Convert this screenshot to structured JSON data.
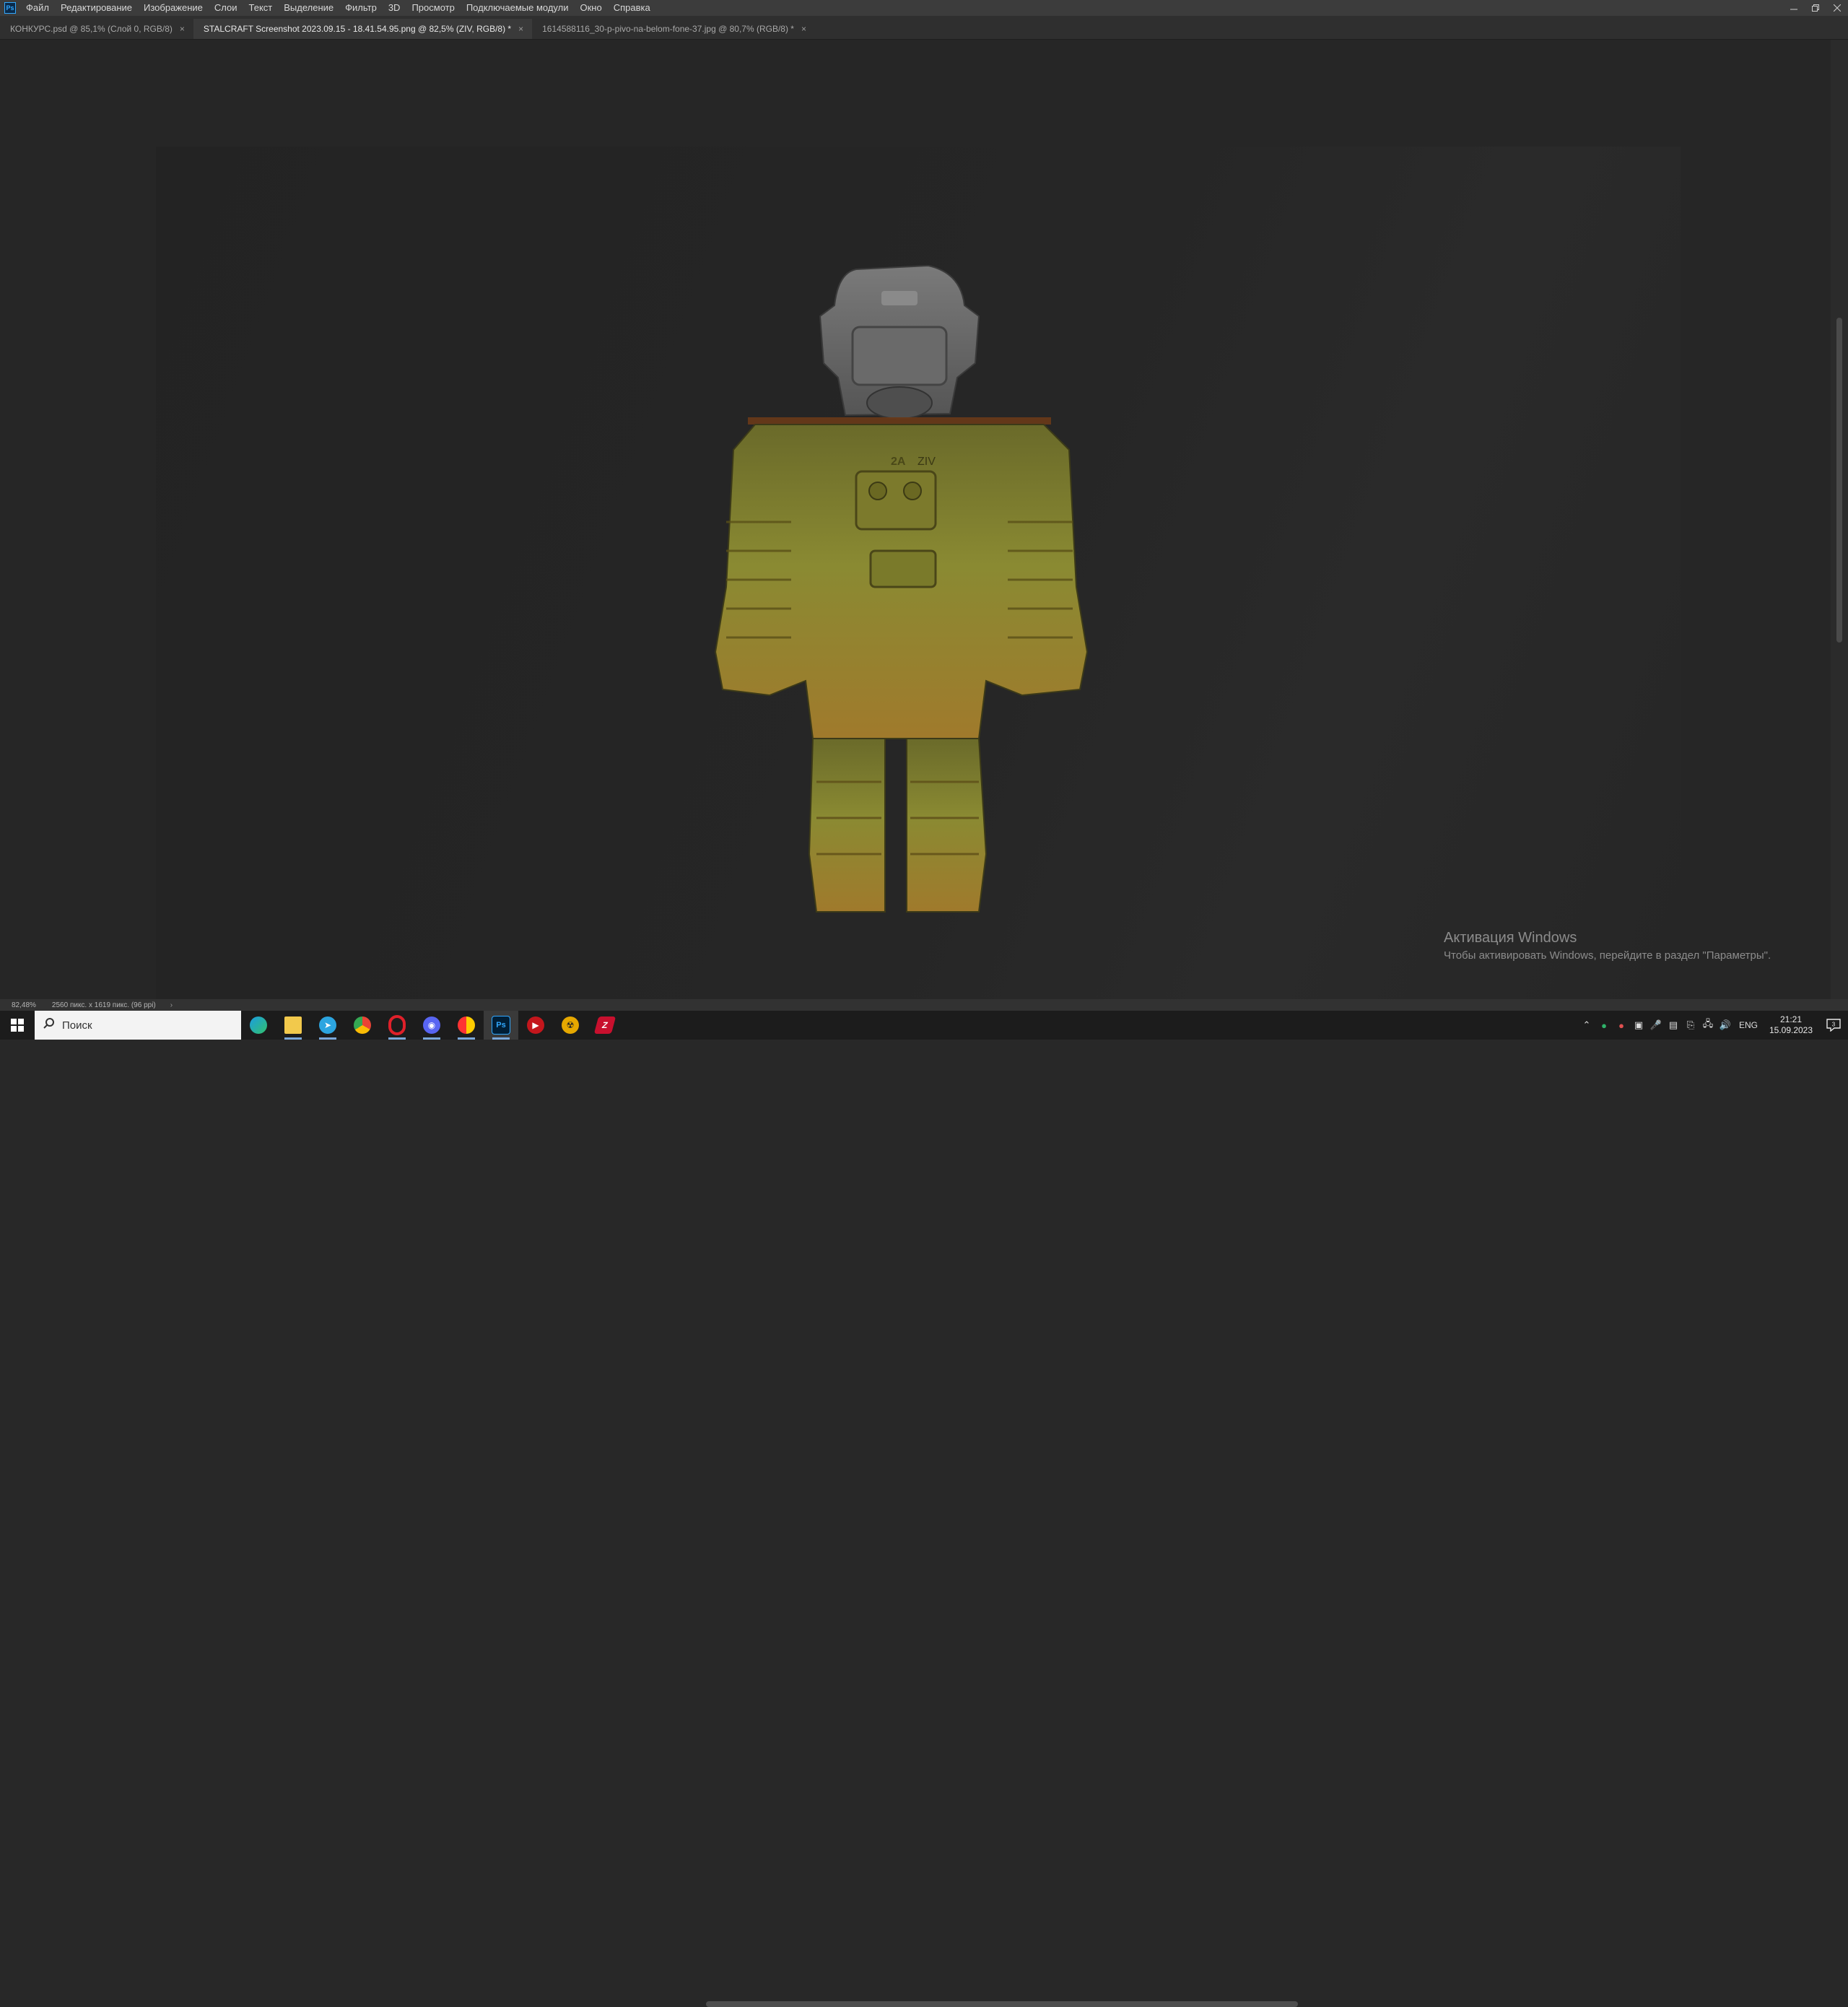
{
  "menu": {
    "app_logo": "Ps",
    "items": [
      "Файл",
      "Редактирование",
      "Изображение",
      "Слои",
      "Текст",
      "Выделение",
      "Фильтр",
      "3D",
      "Просмотр",
      "Подключаемые модули",
      "Окно",
      "Справка"
    ],
    "window_buttons": [
      "minimize-icon",
      "restore-icon",
      "close-icon"
    ]
  },
  "tabs": [
    {
      "label": "КОНКУРС.psd @ 85,1% (Слой 0, RGB/8)",
      "active": false
    },
    {
      "label": "STALCRAFT Screenshot 2023.09.15 - 18.41.54.95.png @ 82,5% (ZIV, RGB/8) *",
      "active": true
    },
    {
      "label": "1614588116_30-p-pivo-na-belom-fone-37.jpg @ 80,7% (RGB/8) *",
      "active": false
    }
  ],
  "tab_close_glyph": "×",
  "canvas": {
    "suit_marking": "ZIV",
    "suit_number": "2A"
  },
  "status": {
    "zoom": "82,48%",
    "doc_info": "2560 пикс. x 1619 пикс. (96 ppi)",
    "arrow": "›"
  },
  "activation": {
    "title": "Активация Windows",
    "subtitle": "Чтобы активировать Windows, перейдите в раздел \"Параметры\"."
  },
  "taskbar": {
    "search_placeholder": "Поиск",
    "apps": [
      "edge",
      "file-explorer",
      "telegram",
      "chrome",
      "opera",
      "discord",
      "yandex",
      "photoshop",
      "video-player",
      "radiation-game",
      "stalcraft"
    ],
    "active_app": "photoshop",
    "tray": {
      "lang": "ENG",
      "time": "21:21",
      "date": "15.09.2023",
      "notif_count": "3"
    }
  }
}
